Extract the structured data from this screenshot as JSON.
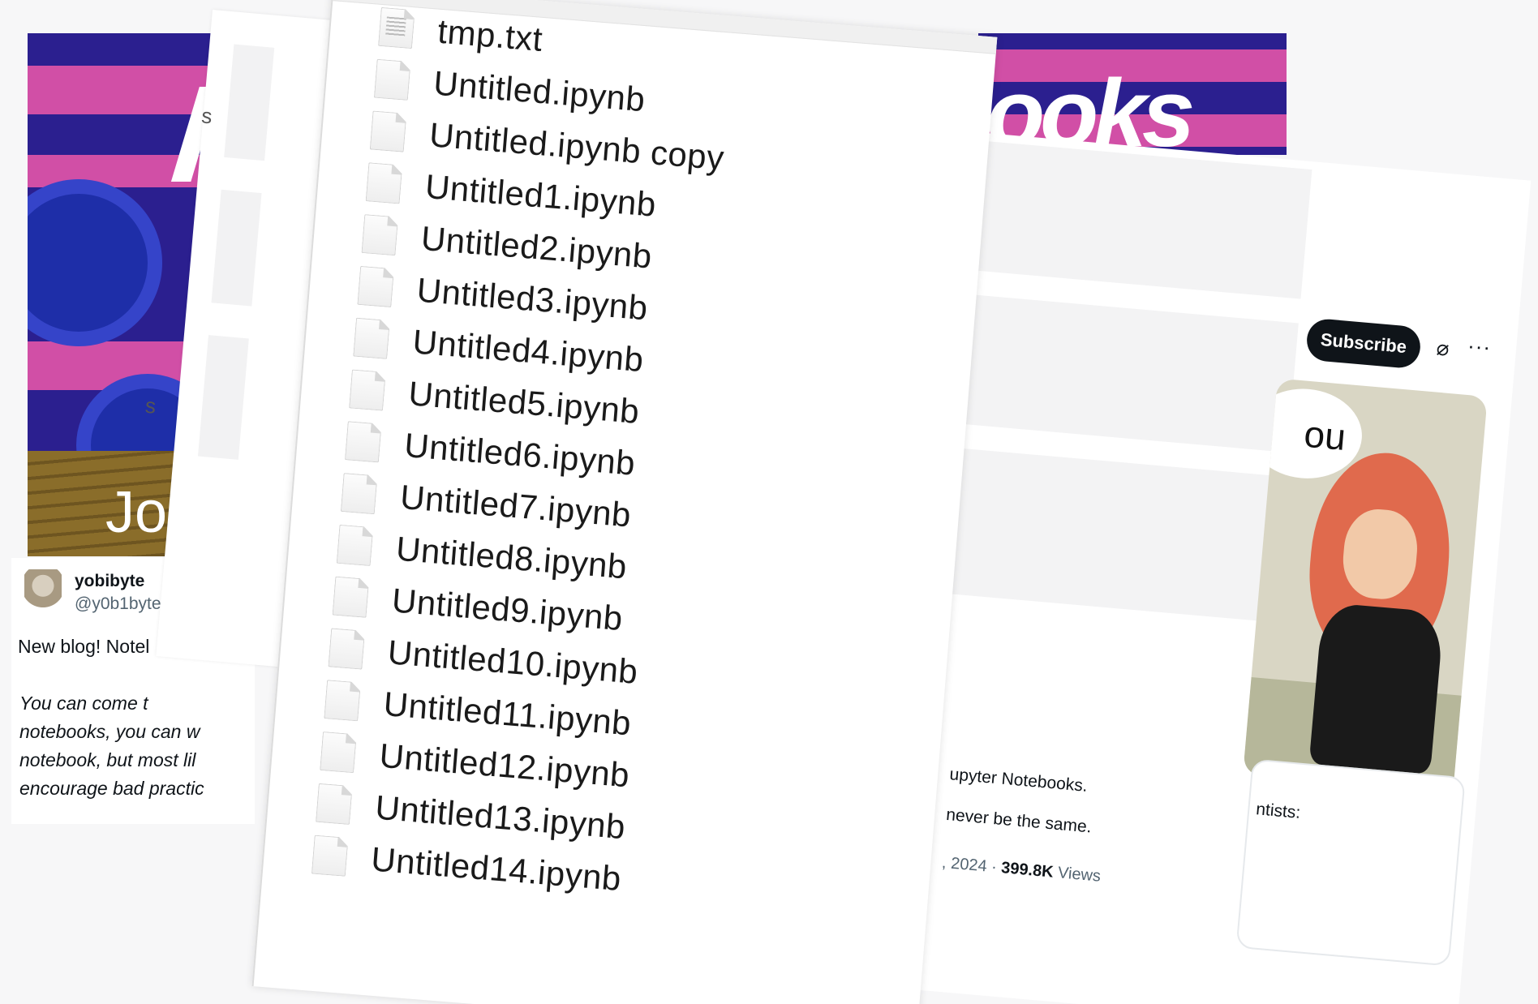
{
  "left_poster": {
    "title_fragment": "I",
    "speaker_fragment": "Joe"
  },
  "left_tweet": {
    "display_name": "yobibyte",
    "handle": "@y0b1byte",
    "lead_text": "New blog! Notel",
    "quote_lines": [
      "You can come t",
      "notebooks, you can w",
      "notebook,  but most lil",
      "encourage bad practic"
    ]
  },
  "faint_sheet": {
    "glyphs": [
      "s",
      "s",
      "I",
      "I",
      "-",
      "I"
    ]
  },
  "right_poster": {
    "title_fragment": "ooks"
  },
  "right_tweet": {
    "subscribe_label": "Subscribe",
    "grok_icon": "⌀",
    "more_icon": "···",
    "meme_caption_fragment": "ou",
    "text_line_1a": "upyter Notebooks.",
    "text_line_1b": "ntists:",
    "text_line_2": "never be the same.",
    "date_fragment": ", 2024 · ",
    "views_count": "399.8K",
    "views_label": " Views"
  },
  "finder": {
    "files": [
      {
        "name": "tmp.txt",
        "icon": "text-file-icon"
      },
      {
        "name": "Untitled.ipynb",
        "icon": "document-icon"
      },
      {
        "name": "Untitled.ipynb copy",
        "icon": "document-icon"
      },
      {
        "name": "Untitled1.ipynb",
        "icon": "document-icon"
      },
      {
        "name": "Untitled2.ipynb",
        "icon": "document-icon"
      },
      {
        "name": "Untitled3.ipynb",
        "icon": "document-icon"
      },
      {
        "name": "Untitled4.ipynb",
        "icon": "document-icon"
      },
      {
        "name": "Untitled5.ipynb",
        "icon": "document-icon"
      },
      {
        "name": "Untitled6.ipynb",
        "icon": "document-icon"
      },
      {
        "name": "Untitled7.ipynb",
        "icon": "document-icon"
      },
      {
        "name": "Untitled8.ipynb",
        "icon": "document-icon"
      },
      {
        "name": "Untitled9.ipynb",
        "icon": "document-icon"
      },
      {
        "name": "Untitled10.ipynb",
        "icon": "document-icon"
      },
      {
        "name": "Untitled11.ipynb",
        "icon": "document-icon"
      },
      {
        "name": "Untitled12.ipynb",
        "icon": "document-icon"
      },
      {
        "name": "Untitled13.ipynb",
        "icon": "document-icon"
      },
      {
        "name": "Untitled14.ipynb",
        "icon": "document-icon"
      }
    ]
  },
  "colors": {
    "poster_blue": "#2b1f8f",
    "poster_pink": "#d14fa6",
    "subscribe_bg": "#0f1419",
    "muted_text": "#536471"
  }
}
